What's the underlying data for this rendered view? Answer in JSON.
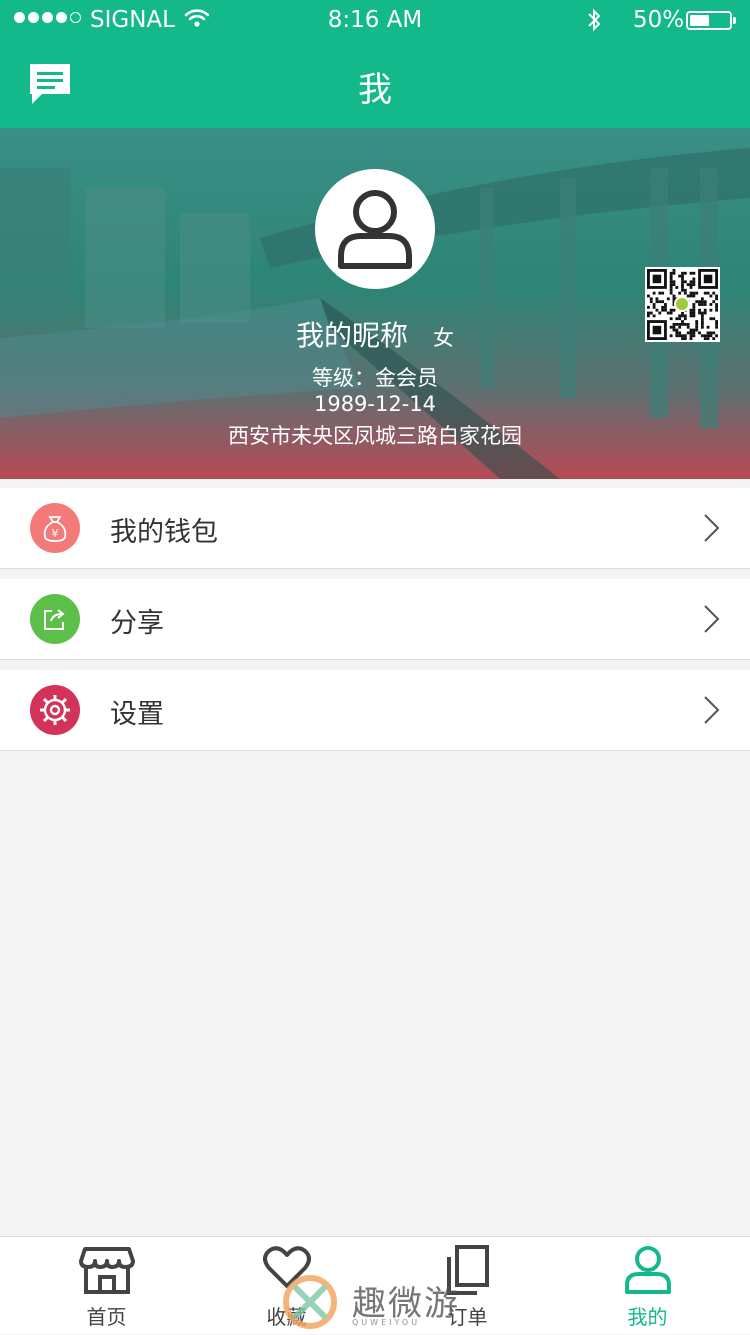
{
  "status_bar": {
    "carrier": "SIGNAL",
    "time": "8:16 AM",
    "battery": "50%",
    "battery_level": 0.5
  },
  "nav": {
    "title": "我",
    "left_icon": "message-icon"
  },
  "profile": {
    "nickname": "我的昵称",
    "gender": "女",
    "level": "等级：金会员",
    "birthday": "1989-12-14",
    "address": "西安市未央区凤城三路白家花园",
    "avatar_icon": "user-icon",
    "qr_icon": "qr-code-icon"
  },
  "menu": [
    {
      "label": "我的钱包",
      "icon": "money-bag-icon",
      "color": "#f47a7a"
    },
    {
      "label": "分享",
      "icon": "share-icon",
      "color": "#5cbf4a"
    },
    {
      "label": "设置",
      "icon": "settings-gear-icon",
      "color": "#d2335a"
    }
  ],
  "tabs": [
    {
      "label": "首页",
      "icon": "store-icon",
      "active": false
    },
    {
      "label": "收藏",
      "icon": "heart-icon",
      "active": false
    },
    {
      "label": "订单",
      "icon": "orders-icon",
      "active": false
    },
    {
      "label": "我的",
      "icon": "user-icon",
      "active": true
    }
  ],
  "watermark": {
    "text": "趣微游",
    "subtext": "QUWEIYOU"
  },
  "colors": {
    "primary": "#13b98b",
    "background": "#f4f4f4"
  }
}
